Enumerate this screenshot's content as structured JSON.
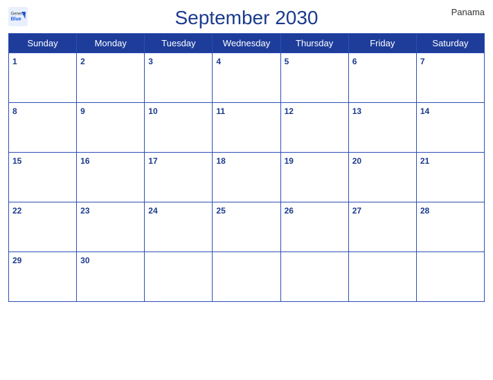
{
  "header": {
    "title": "September 2030",
    "country": "Panama",
    "logo": {
      "general": "General",
      "blue": "Blue"
    }
  },
  "weekdays": [
    "Sunday",
    "Monday",
    "Tuesday",
    "Wednesday",
    "Thursday",
    "Friday",
    "Saturday"
  ],
  "weeks": [
    [
      {
        "day": 1,
        "empty": false
      },
      {
        "day": 2,
        "empty": false
      },
      {
        "day": 3,
        "empty": false
      },
      {
        "day": 4,
        "empty": false
      },
      {
        "day": 5,
        "empty": false
      },
      {
        "day": 6,
        "empty": false
      },
      {
        "day": 7,
        "empty": false
      }
    ],
    [
      {
        "day": 8,
        "empty": false
      },
      {
        "day": 9,
        "empty": false
      },
      {
        "day": 10,
        "empty": false
      },
      {
        "day": 11,
        "empty": false
      },
      {
        "day": 12,
        "empty": false
      },
      {
        "day": 13,
        "empty": false
      },
      {
        "day": 14,
        "empty": false
      }
    ],
    [
      {
        "day": 15,
        "empty": false
      },
      {
        "day": 16,
        "empty": false
      },
      {
        "day": 17,
        "empty": false
      },
      {
        "day": 18,
        "empty": false
      },
      {
        "day": 19,
        "empty": false
      },
      {
        "day": 20,
        "empty": false
      },
      {
        "day": 21,
        "empty": false
      }
    ],
    [
      {
        "day": 22,
        "empty": false
      },
      {
        "day": 23,
        "empty": false
      },
      {
        "day": 24,
        "empty": false
      },
      {
        "day": 25,
        "empty": false
      },
      {
        "day": 26,
        "empty": false
      },
      {
        "day": 27,
        "empty": false
      },
      {
        "day": 28,
        "empty": false
      }
    ],
    [
      {
        "day": 29,
        "empty": false
      },
      {
        "day": 30,
        "empty": false
      },
      {
        "day": null,
        "empty": true
      },
      {
        "day": null,
        "empty": true
      },
      {
        "day": null,
        "empty": true
      },
      {
        "day": null,
        "empty": true
      },
      {
        "day": null,
        "empty": true
      }
    ]
  ],
  "colors": {
    "header_bg": "#1e3d9b",
    "header_text": "#ffffff",
    "title_color": "#1a3a8c",
    "border_color": "#2b4eb5",
    "day_number_color": "#1a3a8c"
  }
}
